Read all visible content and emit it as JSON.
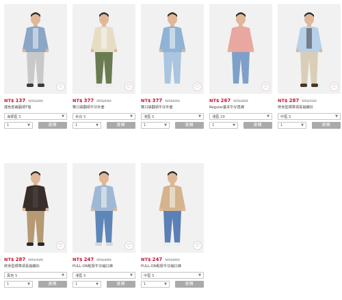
{
  "products": [
    {
      "currency": "NT$",
      "price": "137",
      "original_price": "NT$199",
      "name": "撞色剪裁圓領T恤",
      "color": "海軍藍 S",
      "qty": "1",
      "add_label": "選購",
      "icon": "heart-icon",
      "palette": {
        "bg": "#f1f1f1",
        "top": "#8ba6c6",
        "bottom": "#c9c9c9",
        "skin": "#e0b797",
        "shoe": "#3b3b3b",
        "hair": "#2a2a2a",
        "accent": "#f2f2f2"
      }
    },
    {
      "currency": "NT$",
      "price": "377",
      "original_price": "NT$590",
      "name": "雙口袋翻領牛仔外套",
      "color": "米白 S",
      "qty": "1",
      "add_label": "選購",
      "icon": "heart-icon",
      "palette": {
        "bg": "#f1f1f1",
        "top": "#e7ddc5",
        "bottom": "#6a7b52",
        "skin": "#e0b797",
        "shoe": "#ececec",
        "hair": "#2a2a2a",
        "accent": "#f7f7f7"
      }
    },
    {
      "currency": "NT$",
      "price": "377",
      "original_price": "NT$590",
      "name": "雙口袋翻領牛仔外套",
      "color": "淺藍 S",
      "qty": "1",
      "add_label": "選購",
      "icon": "heart-icon",
      "palette": {
        "bg": "#f1f1f1",
        "top": "#8fb3d6",
        "bottom": "#a9c5df",
        "skin": "#e0b797",
        "shoe": "#f0f0f0",
        "hair": "#2a2a2a",
        "accent": "#f7f7f7"
      }
    },
    {
      "currency": "NT$",
      "price": "267",
      "original_price": "NT$399",
      "name": "Regular基本牛仔直褲",
      "color": "淺藍 29",
      "qty": "1",
      "add_label": "選購",
      "icon": "heart-icon",
      "palette": {
        "bg": "#f1f1f1",
        "top": "#e8a7a0",
        "bottom": "#7ea0c8",
        "skin": "#e0b797",
        "shoe": "#f0f0f0",
        "hair": "#2a2a2a",
        "accent": "#e8a7a0"
      }
    },
    {
      "currency": "NT$",
      "price": "287",
      "original_price": "NT$429",
      "name": "修身型標準領長袖襯衫",
      "color": "中藍 S",
      "qty": "1",
      "add_label": "選購",
      "icon": "heart-icon",
      "palette": {
        "bg": "#f1f1f1",
        "top": "#b8d0e8",
        "bottom": "#d9ceb8",
        "skin": "#e0b797",
        "shoe": "#4a3526",
        "hair": "#2a2a2a",
        "accent": "#3b3b3b"
      }
    },
    {
      "currency": "NT$",
      "price": "287",
      "original_price": "NT$429",
      "name": "修身型標準領長袖襯衫",
      "color": "黑色 S",
      "qty": "1",
      "add_label": "選購",
      "icon": "heart-icon",
      "palette": {
        "bg": "#f1f1f1",
        "top": "#3a2e29",
        "bottom": "#b59a72",
        "skin": "#e0b797",
        "shoe": "#2a2a2a",
        "hair": "#2a2a2a",
        "accent": "#4b4b4b"
      }
    },
    {
      "currency": "NT$",
      "price": "247",
      "original_price": "NT$369",
      "name": "PULL-ON鬆緊牛仔縮口褲",
      "color": "淺藍 S",
      "qty": "1",
      "add_label": "選購",
      "icon": "heart-icon",
      "palette": {
        "bg": "#f1f1f1",
        "top": "#9fb8d4",
        "bottom": "#5f86b8",
        "skin": "#e0b797",
        "shoe": "#d8d8d8",
        "hair": "#2a2a2a",
        "accent": "#f7f7f7"
      }
    },
    {
      "currency": "NT$",
      "price": "247",
      "original_price": "NT$369",
      "name": "PULL-ON鬆緊牛仔縮口褲",
      "color": "中藍 S",
      "qty": "1",
      "add_label": "選購",
      "icon": "heart-icon",
      "palette": {
        "bg": "#f1f1f1",
        "top": "#d4b48c",
        "bottom": "#5b80b5",
        "skin": "#e0b797",
        "shoe": "#ececec",
        "hair": "#2a2a2a",
        "accent": "#f7f7f7"
      }
    }
  ],
  "theme": {
    "price_color": "#c8102e",
    "button_color": "#aaaaaa"
  }
}
